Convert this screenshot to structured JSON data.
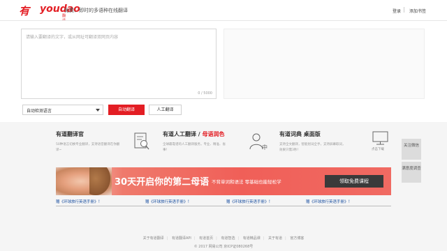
{
  "header": {
    "logo_cn": "有道",
    "logo_en": "youdao",
    "logo_sub": "翻译",
    "slogan": "免费、即时的多语种在线翻译",
    "login": "登录",
    "add_bookmark": "添加书签"
  },
  "translator": {
    "placeholder": "请输入要翻译的文字，或从网址可翻译双网页内容",
    "char_count": "0 / 5000",
    "language": "自动检测语言",
    "translate_button": "自动翻译",
    "human_button": "人工翻译"
  },
  "products": [
    {
      "title": "有道翻译官",
      "desc": "50种语言切换专业翻译，支持语音翻译在你翻译~",
      "icon": "document-search-icon"
    },
    {
      "title": "有道人工翻译 / ",
      "title_accent": "母语润色",
      "desc": "全球最靠谱的人工翻译服务，专业、精准、省事！",
      "icon": "person-translate-icon"
    },
    {
      "title": "有道词典 桌面版",
      "desc": "支持全文翻译，智能划词全手，支持屏幕取词，效果只需3秒！",
      "icon": "monitor-icon",
      "icon_label": "点击下载"
    }
  ],
  "side": {
    "follow": "关注微信",
    "survey": "满意度调查"
  },
  "banner": {
    "main": "30天开启你的第二母语",
    "sub": "不背单词和语法 零基础也能轻松学",
    "button": "领取免费课程"
  },
  "book_links": [
    "赠《环球旅行英语手册》！",
    "赠《环球旅行英语手册》！",
    "赠《环球旅行英语手册》！",
    "赠《环球旅行英语手册》！"
  ],
  "footer": {
    "links": [
      "关于有道翻译",
      "有道翻译API",
      "有道首页",
      "有道智选",
      "有道精品课",
      "关于有道",
      "官方博客"
    ],
    "copyright": "© 2017 网易公司 京ICP证080268号"
  },
  "colors": {
    "brand_red": "#e31e24",
    "link_blue": "#1a4fa0",
    "banner_red": "#f05f58"
  }
}
